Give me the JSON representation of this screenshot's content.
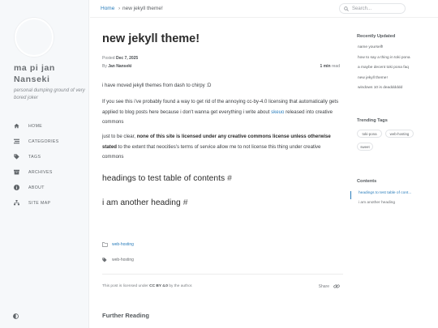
{
  "sidebar": {
    "site_title": "ma pi jan Nanseki",
    "site_subtitle": "personal dumping ground of very bored joker",
    "items": [
      {
        "label": "HOME",
        "icon": "home-icon"
      },
      {
        "label": "CATEGORIES",
        "icon": "stream-icon"
      },
      {
        "label": "TAGS",
        "icon": "tags-icon"
      },
      {
        "label": "ARCHIVES",
        "icon": "archive-icon"
      },
      {
        "label": "ABOUT",
        "icon": "info-circle-icon"
      },
      {
        "label": "SITE MAP",
        "icon": "sitemap-icon"
      }
    ],
    "mode_toggle_icon": "adjust-icon"
  },
  "breadcrumb": {
    "home": "Home",
    "separator": "›",
    "current": "new jekyll theme!"
  },
  "search": {
    "placeholder": "Search..."
  },
  "post": {
    "title": "new jekyll theme!",
    "posted_label": "Posted",
    "posted_date": "Dec 7, 2025",
    "by_label": "By",
    "author": "Jan Nanseki",
    "read_time": "1 min",
    "read_suffix": "read",
    "p1": "i have moved jekyll themes from dash to chirpy :D",
    "p2_a": "If you see this i've probably found a way to get rid of the annoying cc-by-4.0 licensing that automatically gets applied to blog posts here because i don't wanna get everything i write about",
    "p2_link": "skeuo",
    "p2_b": "released into creative commons",
    "p3_a": "just to be clear,",
    "p3_bold": "none of this site is licensed under any creative commons license unless otherwise stated",
    "p3_b": "to the extent that neocities's terms of service allow me to not license this thing under creative commons",
    "h1": "headings to test table of contents",
    "h2": "i am another heading",
    "category": "web-hosting",
    "tag": "web-hosting",
    "license_a": "This post is licensed under",
    "license_b": "CC BY 4.0",
    "license_c": "by the author.",
    "share_label": "Share",
    "further_reading": "Further Reading"
  },
  "panel": {
    "recently_updated_title": "Recently Updated",
    "recently_updated": [
      "name yourself!",
      "how to say a thing in toki pona",
      "a maybe decent toki pona faq",
      "new jekyll theme!",
      "windows 10 is deadddddd"
    ],
    "trending_tags_title": "Trending Tags",
    "trending_tags": [
      "toki-pona",
      "web-hosting",
      "sweet"
    ],
    "contents_title": "Contents",
    "contents": [
      "headings to test table of cont...",
      "i am another heading"
    ]
  },
  "colors": {
    "accent": "#2a7dbb",
    "sidebar_bg": "#f6f8fa"
  }
}
